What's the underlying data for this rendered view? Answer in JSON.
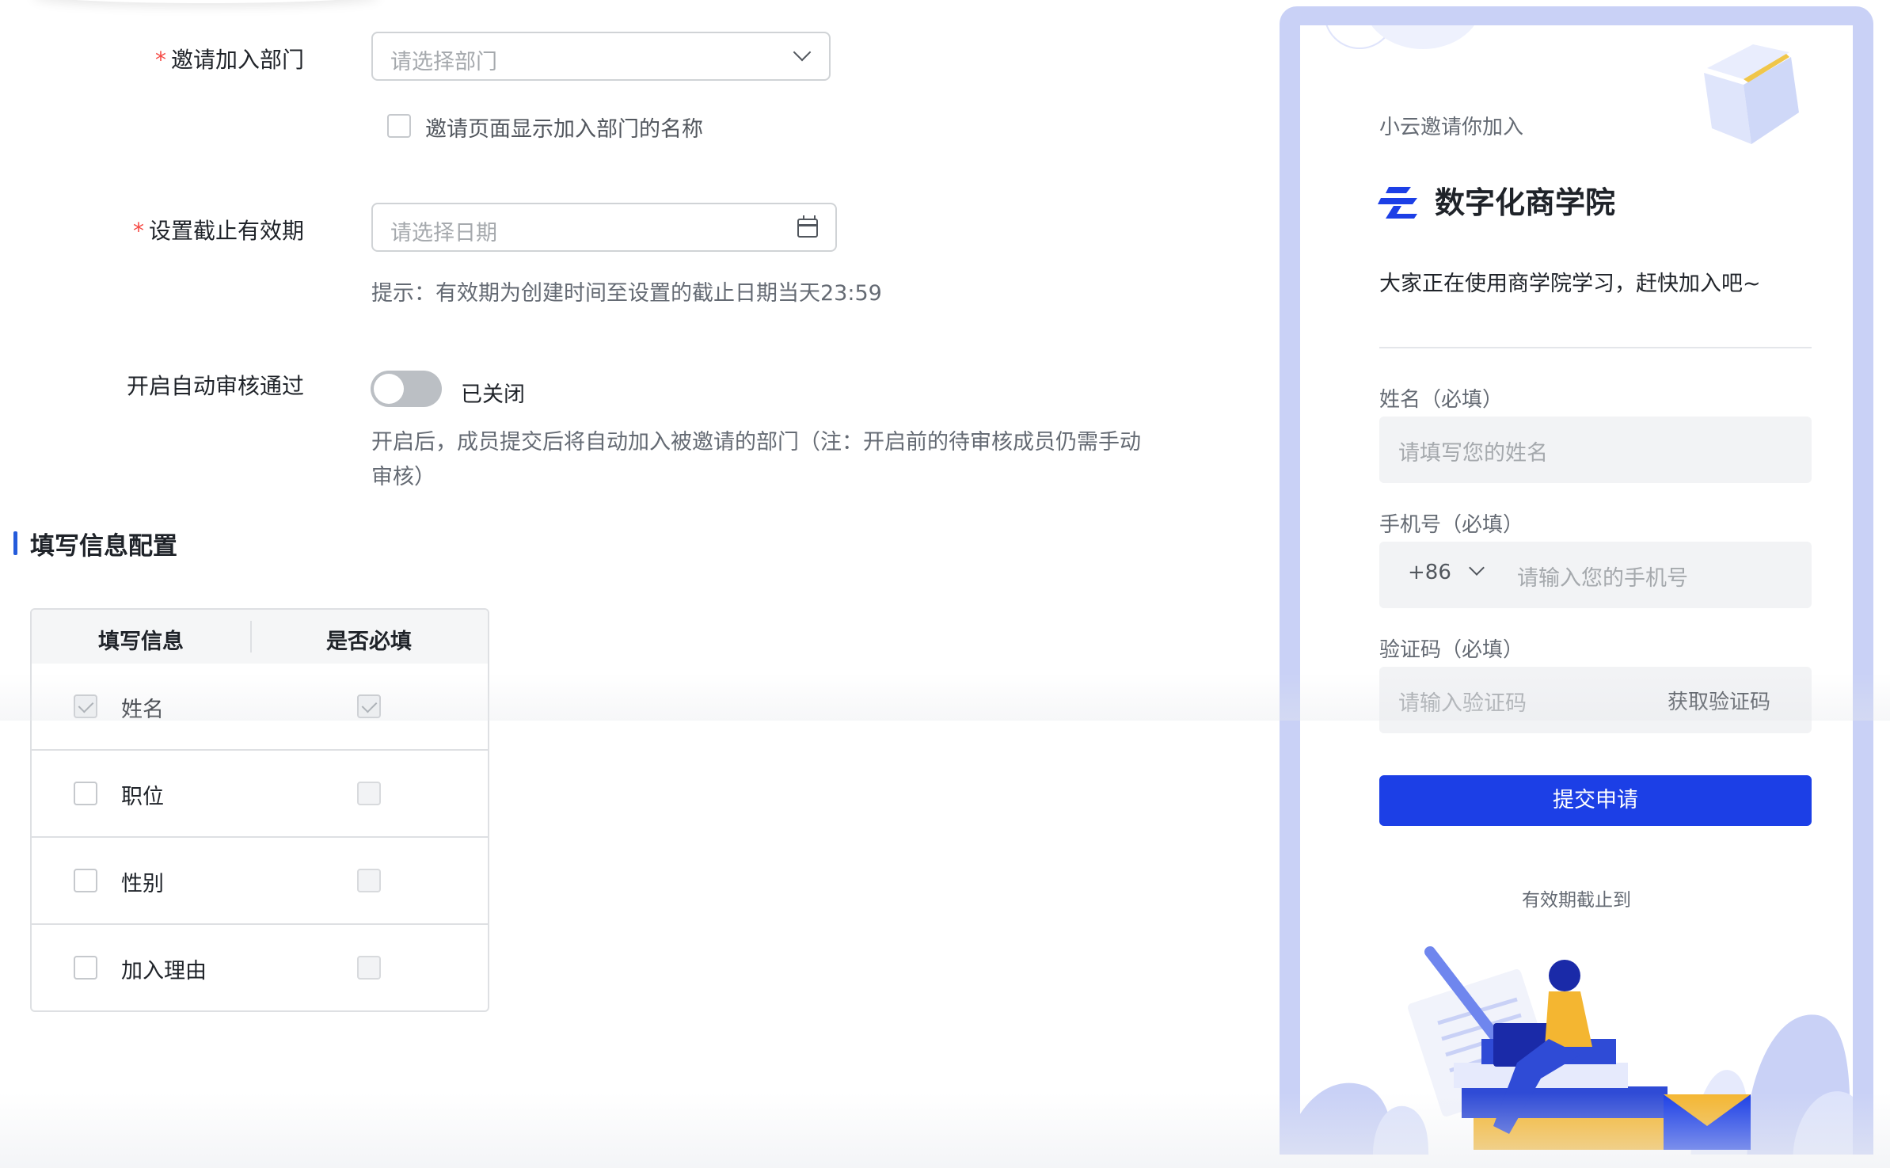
{
  "form": {
    "department": {
      "label": "邀请加入部门",
      "required_mark": "*",
      "placeholder": "请选择部门",
      "show_name_checkbox_label": "邀请页面显示加入部门的名称"
    },
    "expiry": {
      "label": "设置截止有效期",
      "required_mark": "*",
      "placeholder": "请选择日期",
      "hint": "提示：有效期为创建时间至设置的截止日期当天23:59"
    },
    "auto_approve": {
      "label": "开启自动审核通过",
      "state_text": "已关闭",
      "enabled": false,
      "hint_line1": "开启后，成员提交后将自动加入被邀请的部门（注：开启前的待审核成员仍需手动",
      "hint_line2": "审核）"
    }
  },
  "info_config": {
    "title": "填写信息配置",
    "columns": [
      "填写信息",
      "是否必填"
    ],
    "rows": [
      {
        "name": "姓名",
        "selected": true,
        "required": true,
        "disabled": true
      },
      {
        "name": "职位",
        "selected": false,
        "required": false,
        "disabled": false
      },
      {
        "name": "性别",
        "selected": false,
        "required": false,
        "disabled": false
      },
      {
        "name": "加入理由",
        "selected": false,
        "required": false,
        "disabled": false
      }
    ]
  },
  "preview": {
    "invite_text": "小云邀请你加入",
    "org_name": "数字化商学院",
    "description": "大家正在使用商学院学习，赶快加入吧~",
    "name_label": "姓名（必填）",
    "name_placeholder": "请填写您的姓名",
    "phone_label": "手机号（必填）",
    "country_code": "+86",
    "phone_placeholder": "请输入您的手机号",
    "code_label": "验证码（必填）",
    "code_placeholder": "请输入验证码",
    "get_code": "获取验证码",
    "submit": "提交申请",
    "valid_until": "有效期截止到"
  },
  "colors": {
    "accent": "#1c3fe6",
    "section_bar": "#245bdb",
    "required": "#f54a45",
    "phone_frame": "#c9d1f6"
  }
}
